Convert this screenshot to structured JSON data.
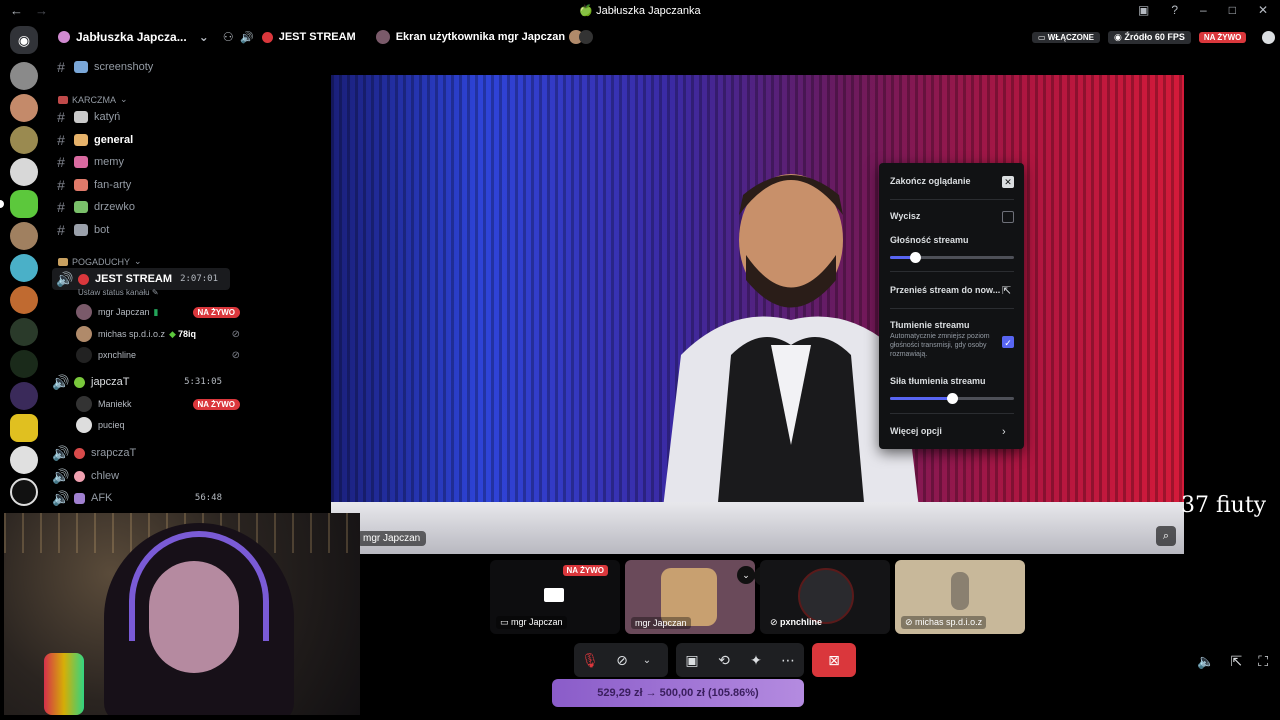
{
  "window": {
    "title": "🍏 Jabłuszka Japczanka"
  },
  "server": {
    "name": "Jabłuszka Japcza..."
  },
  "channels": [
    {
      "name": "screenshoty",
      "emoji_color": "#7aa7d8",
      "active": false
    },
    {
      "category": "KARCZMA"
    },
    {
      "name": "katyń",
      "emoji_color": "#c9c9c9",
      "active": false
    },
    {
      "name": "general",
      "emoji_color": "#e6b26a",
      "active": true
    },
    {
      "name": "memy",
      "emoji_color": "#d96aa0",
      "active": false
    },
    {
      "name": "fan-arty",
      "emoji_color": "#e07a6a",
      "active": false
    },
    {
      "name": "drzewko",
      "emoji_color": "#7ac06a",
      "active": false
    },
    {
      "name": "bot",
      "emoji_color": "#9aa0aa",
      "active": false
    }
  ],
  "categories": {
    "karczma": "KARCZMA",
    "pogaduchy": "POGADUCHY"
  },
  "voice": {
    "jest_stream": {
      "name": "JEST STREAM",
      "timer": "2:07:01",
      "status": "Ustaw status kanału"
    },
    "jest_users": [
      {
        "name": "mgr Japczan",
        "badge": "NA ŻYWO"
      },
      {
        "name": "michas sp.d.i.o.z",
        "extra": "78iq"
      },
      {
        "name": "pxnchline"
      }
    ],
    "japczat": {
      "name": "japczaT",
      "timer": "5:31:05"
    },
    "japczat_users": [
      {
        "name": "Maniekk",
        "badge": "NA ŻYWO"
      },
      {
        "name": "pucieq"
      }
    ],
    "others": [
      {
        "name": "srapczaT"
      },
      {
        "name": "chlew"
      },
      {
        "name": "AFK",
        "timer": "56:48"
      }
    ]
  },
  "stream_header": {
    "channel": "JEST STREAM",
    "screen_of": "Ekran użytkownika mgr Japczan",
    "enabled_badge": "WŁĄCZONE",
    "source": "Źródło 60 FPS",
    "live": "NA ŻYWO"
  },
  "video": {
    "name_tag": "mgr Japczan"
  },
  "menu": {
    "stop_watching": "Zakończ oglądanie",
    "mute": "Wycisz",
    "mute_checked": false,
    "volume_label": "Głośność streamu",
    "volume_value": 0.2,
    "popout": "Przenieś stream do now...",
    "attenuation_label": "Tłumienie streamu",
    "attenuation_desc": "Automatycznie zmniejsz poziom głośności transmisji, gdy osoby rozmawiają.",
    "attenuation_checked": true,
    "attenuation_strength_label": "Siła tłumienia streamu",
    "attenuation_strength": 0.5,
    "more": "Więcej opcji"
  },
  "tiles": [
    {
      "label": "mgr Japczan",
      "badge": "NA ŻYWO",
      "kind": "screen"
    },
    {
      "label": "mgr Japczan",
      "kind": "camera"
    },
    {
      "label": "pxnchline",
      "kind": "avatar"
    },
    {
      "label": "michas sp.d.i.o.z",
      "kind": "camera"
    }
  ],
  "donation": {
    "text": "529,29 zł → 500,00 zł (105.86%)"
  },
  "overlay_text": "37 fiuty",
  "colors": {
    "accent": "#5865f2",
    "danger": "#da373c",
    "bg": "#000000"
  }
}
